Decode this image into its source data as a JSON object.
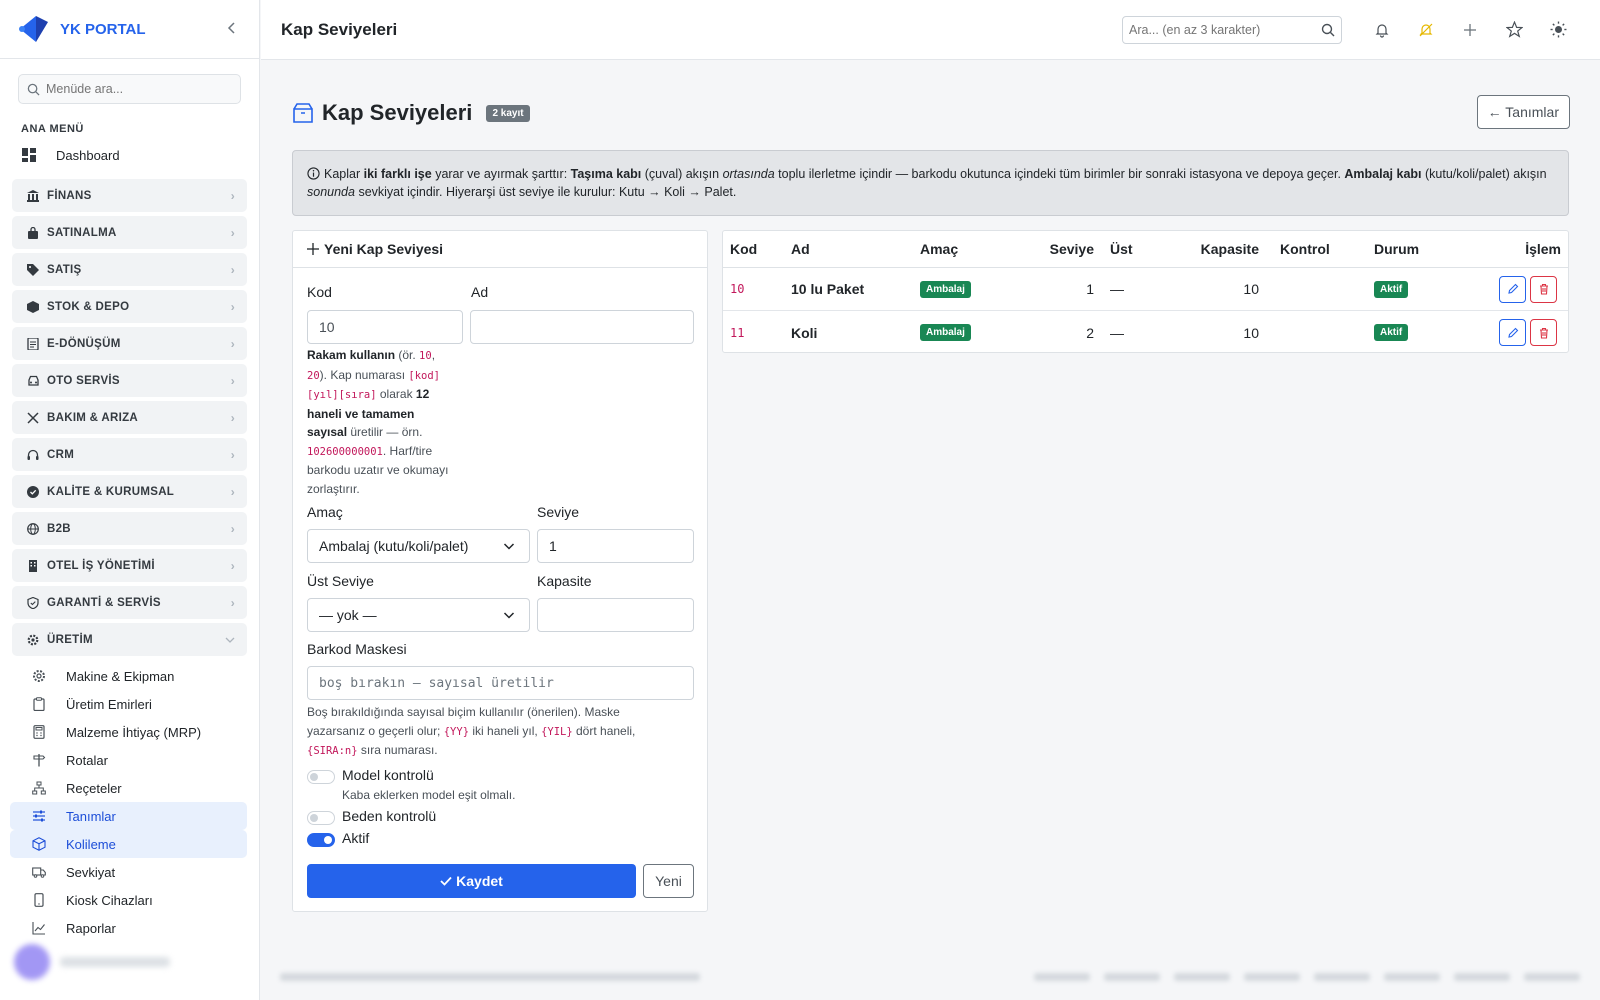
{
  "brand": {
    "name": "YK PORTAL"
  },
  "sidebar": {
    "search_placeholder": "Menüde ara...",
    "section_title": "ANA MENÜ",
    "dashboard": "Dashboard",
    "groups": [
      {
        "label": "FİNANS",
        "icon": "bank-icon"
      },
      {
        "label": "SATINALMA",
        "icon": "bag-icon"
      },
      {
        "label": "SATIŞ",
        "icon": "tag-icon"
      },
      {
        "label": "STOK & DEPO",
        "icon": "box-icon"
      },
      {
        "label": "E-DÖNÜŞÜM",
        "icon": "document-icon"
      },
      {
        "label": "OTO SERVİS",
        "icon": "car-icon"
      },
      {
        "label": "BAKIM & ARIZA",
        "icon": "wrench-icon"
      },
      {
        "label": "CRM",
        "icon": "headset-icon"
      },
      {
        "label": "KALİTE & KURUMSAL",
        "icon": "seal-icon"
      },
      {
        "label": "B2B",
        "icon": "globe-icon"
      },
      {
        "label": "OTEL İŞ YÖNETİMİ",
        "icon": "building-icon"
      },
      {
        "label": "GARANTİ & SERVİS",
        "icon": "shield-icon"
      },
      {
        "label": "ÜRETİM",
        "icon": "gear-icon"
      }
    ],
    "uretim_items": [
      "Makine & Ekipman",
      "Üretim Emirleri",
      "Malzeme İhtiyaç (MRP)",
      "Rotalar",
      "Reçeteler",
      "Tanımlar",
      "Kolileme",
      "Sevkiyat",
      "Kiosk Cihazları",
      "Raporlar"
    ]
  },
  "topbar": {
    "title": "Kap Seviyeleri",
    "search_placeholder": "Ara... (en az 3 karakter)"
  },
  "page": {
    "title": "Kap Seviyeleri",
    "badge": "2 kayıt",
    "back_label": "← Tanımlar"
  },
  "info": {
    "t1": "Kaplar ",
    "b1": "iki farklı işe",
    "t2": " yarar ve ayırmak şarttır: ",
    "b2": "Taşıma kabı",
    "t3": " (çuval) akışın ",
    "i1": "ortasında",
    "t4": " toplu ilerletme içindir — barkodu okutunca içindeki tüm birimler bir sonraki istasyona ve depoya geçer. ",
    "b3": "Ambalaj kabı",
    "t5": " (kutu/koli/palet) akışın ",
    "i2": "sonunda",
    "t6": " sevkiyat içindir. Hiyerarşi üst seviye ile kurulur: Kutu → Koli → Palet."
  },
  "form": {
    "header": "Yeni Kap Seviyesi",
    "kod_label": "Kod",
    "kod_value": "10",
    "ad_label": "Ad",
    "ad_value": "",
    "help1": {
      "b1": "Rakam kullanın",
      "t1": " (ör. ",
      "c1": "10",
      "t2": ", ",
      "c2": "20",
      "t3": "). Kap numarası ",
      "c3": "[kod]",
      "c4": "[yıl][sıra]",
      "t4": " olarak ",
      "b2": "12",
      "b3": "haneli ve tamamen",
      "b4": "sayısal",
      "t5": " üretilir — örn.",
      "c5": "102600000001",
      "t6": ". Harf/tire",
      "t7": "barkodu uzatır ve okumayı",
      "t8": "zorlaştırır."
    },
    "amac_label": "Amaç",
    "amac_value": "Ambalaj (kutu/koli/palet)",
    "seviye_label": "Seviye",
    "seviye_value": "1",
    "ust_label": "Üst Seviye",
    "ust_value": "— yok —",
    "kapasite_label": "Kapasite",
    "kapasite_value": "",
    "barkod_label": "Barkod Maskesi",
    "barkod_placeholder": "boş bırakın — sayısal üretilir",
    "help2": {
      "t1": "Boş bırakıldığında sayısal biçim kullanılır (önerilen). Maske",
      "t2": "yazarsanız o geçerli olur; ",
      "c1": "{YY}",
      "t3": " iki haneli yıl, ",
      "c2": "{YIL}",
      "t4": " dört haneli,",
      "c3": "{SIRA:n}",
      "t5": " sıra numarası."
    },
    "model_label": "Model kontrolü",
    "model_sub": "Kaba eklerken model eşit olmalı.",
    "beden_label": "Beden kontrolü",
    "aktif_label": "Aktif",
    "save_label": "Kaydet",
    "new_label": "Yeni"
  },
  "table": {
    "headers": [
      "Kod",
      "Ad",
      "Amaç",
      "Seviye",
      "Üst",
      "Kapasite",
      "Kontrol",
      "Durum",
      "İşlem"
    ],
    "rows": [
      {
        "kod": "10",
        "ad": "10 lu Paket",
        "amac": "Ambalaj",
        "seviye": "1",
        "ust": "—",
        "kapasite": "10",
        "kontrol": "",
        "durum": "Aktif"
      },
      {
        "kod": "11",
        "ad": "Koli",
        "amac": "Ambalaj",
        "seviye": "2",
        "ust": "—",
        "kapasite": "10",
        "kontrol": "",
        "durum": "Aktif"
      }
    ]
  },
  "colors": {
    "primary": "#2563eb",
    "success": "#198754",
    "danger": "#dc3545",
    "code": "#c2185b"
  }
}
